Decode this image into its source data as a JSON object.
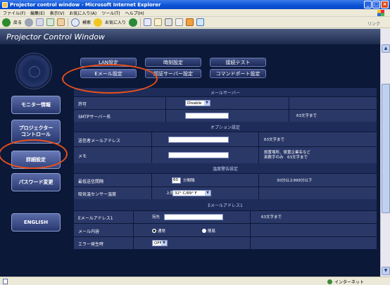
{
  "window": {
    "title": "Projector control window - Microsoft Internet Explorer",
    "min": "_",
    "max": "□",
    "close": "×"
  },
  "menubar": [
    "ファイル(F)",
    "編集(E)",
    "表示(V)",
    "お気に入り(A)",
    "ツール(T)",
    "ヘルプ(H)"
  ],
  "toolbar": {
    "back": "戻る",
    "search": "検索",
    "favorites": "お気に入り",
    "links": "リンク"
  },
  "header": {
    "title": "Projector Control Window"
  },
  "tabs": {
    "lan": "LAN設定",
    "time": "時刻設定",
    "conn_test": "接続テスト",
    "email": "Eメール設定",
    "auth_server": "認証サーバー設定",
    "command_port": "コマンドポート設定"
  },
  "nav": {
    "monitor": "モニター情報",
    "projector_control_1": "プロジェクター",
    "projector_control_2": "コントロール",
    "detail": "詳細設定",
    "password": "パスワード変更",
    "english": "ENGLISH"
  },
  "form": {
    "mail_server_section": "メールサーバー",
    "permit_label": "許可",
    "permit_value": "Disable",
    "smtp_label": "SMTPサーバー名",
    "smtp_note": "63文字まで",
    "option_section": "オプション設定",
    "sender_label": "送信者メールアドレス",
    "sender_note": "63文字まで",
    "memo_label": "メモ",
    "memo_note": "設置場所、設置企業名など\n英数字のみ　63文字まで",
    "temp_section": "温度警告設定",
    "min_interval_label": "最低送信間隔",
    "min_interval_value": "60",
    "min_interval_unit": "分間隔",
    "min_interval_note": "30分以上999分以下",
    "intake_temp_label": "吸気温センサー温度",
    "intake_temp_prefix": "上限",
    "intake_temp_value": "32° C/89° F",
    "email1_section": "Eメールアドレス1",
    "email1_label": "Eメールアドレス1",
    "email1_prefix": "宛先",
    "email1_note": "63文字まで",
    "mail_content_label": "メール内容",
    "radio_normal": "通常",
    "radio_simple": "簡易",
    "error_label": "エラー発生時",
    "error_value": "OFF"
  },
  "status": {
    "zone": "インターネット"
  },
  "colors": {
    "background": "#0c1838",
    "accent": "#e8501c",
    "row": "#2a3868",
    "title_bar": "#0a52d6"
  }
}
